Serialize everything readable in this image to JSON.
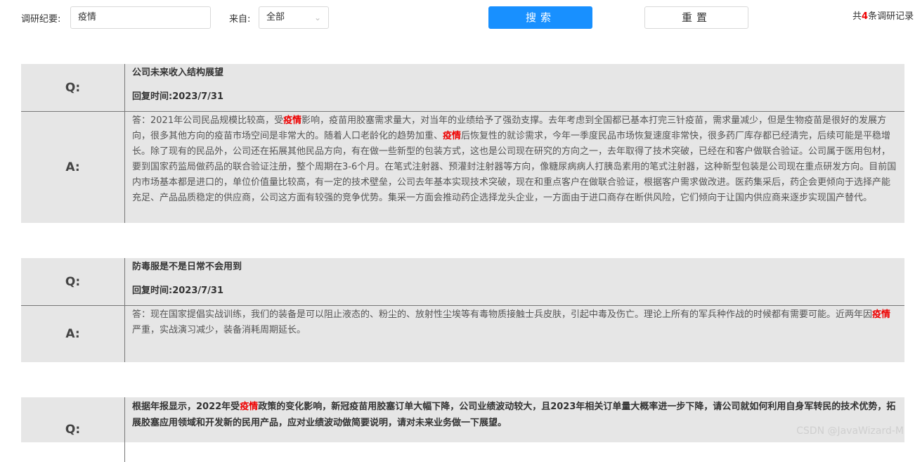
{
  "filters": {
    "keyword_label": "调研纪要:",
    "keyword_value": "疫情",
    "source_label": "来自:",
    "source_value": "全部",
    "search_label": "搜索",
    "reset_label": "重置",
    "total_prefix": "共",
    "total_count": "4",
    "total_suffix": "条调研记录"
  },
  "items": [
    {
      "q_tag": "Q:",
      "a_tag": "A:",
      "question": "公司未来收入结构展望",
      "reply_label": "回复时间:",
      "reply_time": "2023/7/31",
      "answer_parts": [
        "答：2021年公司民品规模比较高，受",
        "疫情",
        "影响，疫苗用胶塞需求量大，对当年的业绩给予了强劲支撑。去年考虑到全国都已基本打完三针疫苗，需求量减少，但是生物疫苗是很好的发展方向，很多其他方向的疫苗市场空间是非常大的。随着人口老龄化的趋势加重、",
        "疫情",
        "后恢复性的就诊需求，今年一季度民品市场恢复速度非常快，很多药厂库存都已经清完，后续可能是平稳增长。除了现有的民品外，公司还在拓展其他民品方向，有在做一些新型的包装方式，这也是公司现在研究的方向之一，去年取得了技术突破，已经在和客户做联合验证。公司属于医用包材，要到国家药监局做药品的联合验证注册，整个周期在3-6个月。在笔式注射器、预灌封注射器等方向，像糖尿病病人打胰岛素用的笔式注射器，这种新型包装是公司现在重点研发方向。目前国内市场基本都是进口的，单位价值量比较高，有一定的技术壁垒，公司去年基本实现技术突破，现在和重点客户在做联合验证，根据客户需求做改进。医药集采后，药企会更倾向于选择产能充足、产品品质稳定的供应商，公司这方面有较强的竞争优势。集采一方面会推动药企选择龙头企业，一方面由于进口商存在断供风险，它们倾向于让国内供应商来逐步实现国产替代。"
      ]
    },
    {
      "q_tag": "Q:",
      "a_tag": "A:",
      "question": "防毒服是不是日常不会用到",
      "reply_label": "回复时间:",
      "reply_time": "2023/7/31",
      "answer_parts": [
        "答：现在国家提倡实战训练，我们的装备是可以阻止液态的、粉尘的、放射性尘埃等有毒物质接触士兵皮肤，引起中毒及伤亡。理论上所有的军兵种作战的时候都有需要可能。近两年因",
        "疫情",
        "严重，实战演习减少，装备消耗周期延长。"
      ]
    },
    {
      "q_tag": "Q:",
      "question_parts": [
        "根据年报显示，2022年受",
        "疫情",
        "政策的变化影响，新冠疫苗用胶塞订单大幅下降，公司业绩波动较大，且2023年相关订单量大概率进一步下降，请公司就如何利用自身军转民的技术优势，拓展胶塞应用领域和开发新的民用产品，应对业绩波动做简要说明，请对未来业务做一下展望。"
      ]
    }
  ],
  "watermark": "CSDN @JavaWizard-M",
  "colors": {
    "primary": "#1890ff",
    "highlight": "#e00000",
    "block_bg": "#e6e6e6"
  }
}
